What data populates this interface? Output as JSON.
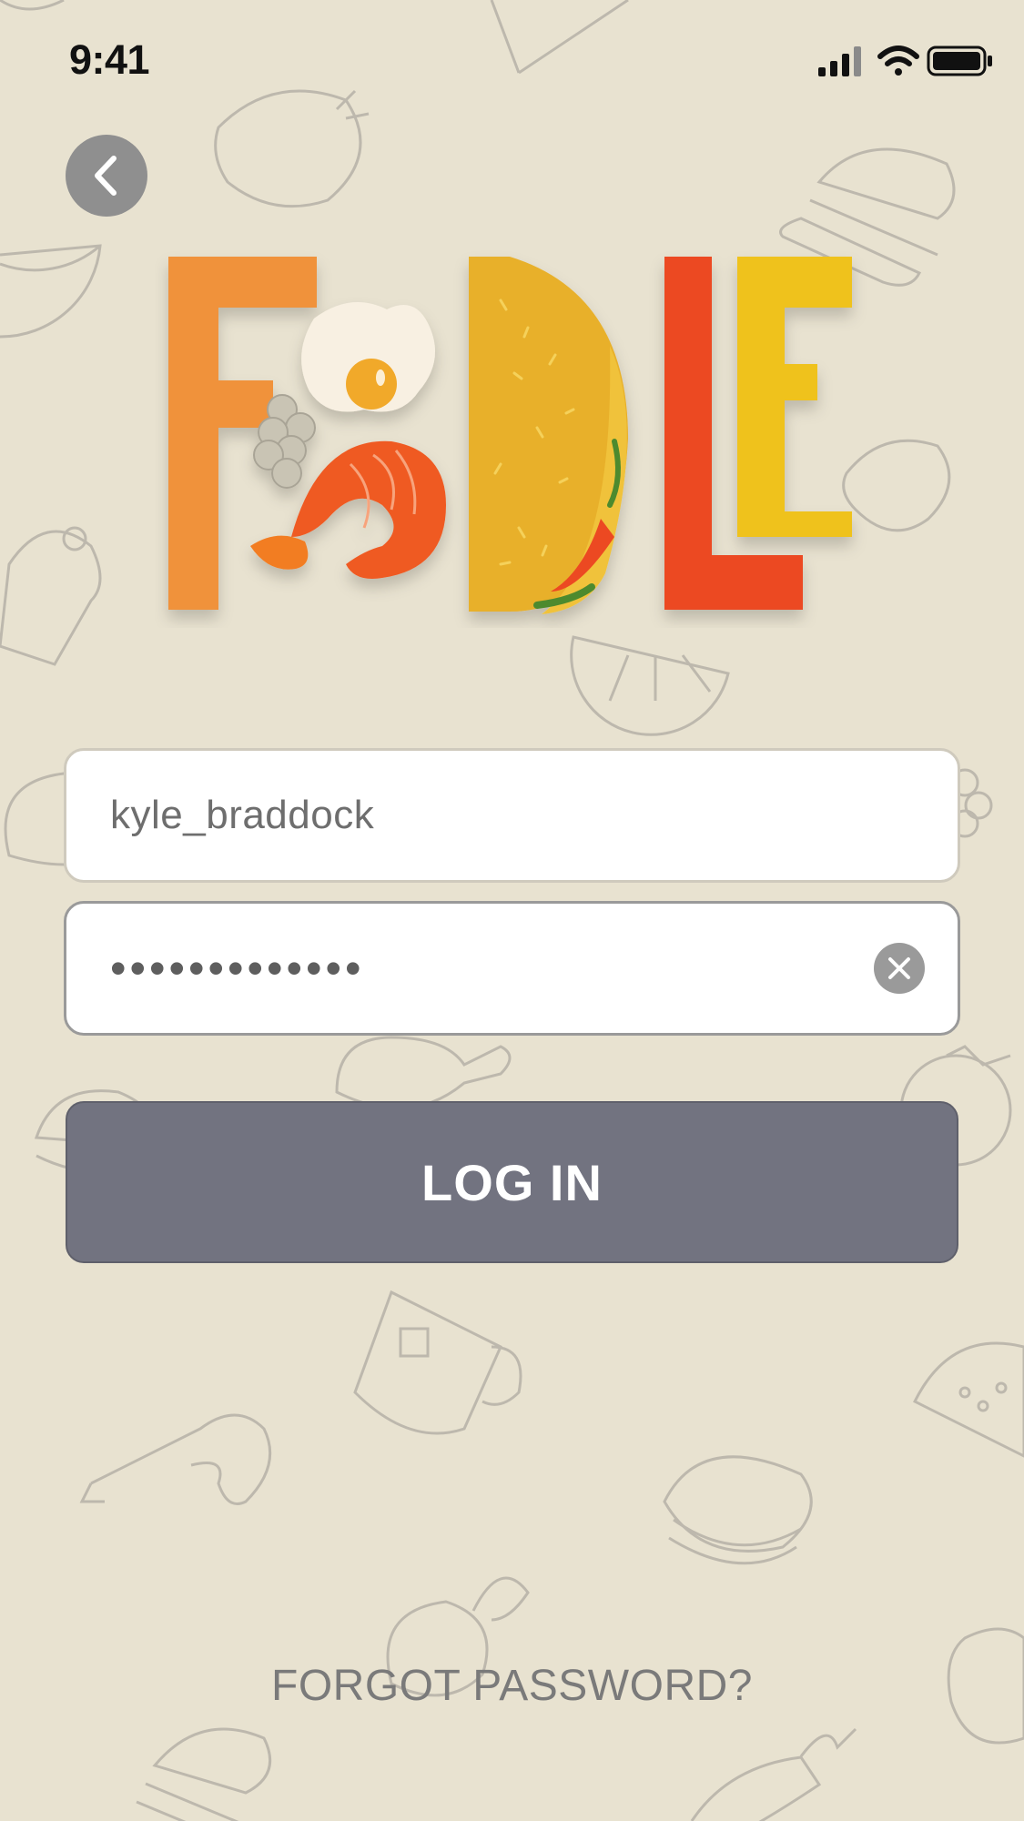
{
  "status_bar": {
    "time": "9:41",
    "signal_icon": "cellular-signal-icon",
    "wifi_icon": "wifi-icon",
    "battery_icon": "battery-icon"
  },
  "header": {
    "back_icon": "chevron-left-icon"
  },
  "logo": {
    "text": "FOODLE",
    "letter_colors": {
      "F": "#f0923a",
      "taco": "#e8b02c",
      "L": "#ec4823",
      "E": "#efc21e"
    }
  },
  "login_form": {
    "username_value": "kyle_braddock",
    "password_value": "•••••••••••••",
    "clear_icon": "clear-circle-icon",
    "submit_label": "LOG IN",
    "forgot_label": "FORGOT PASSWORD?"
  },
  "colors": {
    "background": "#e8e2d0",
    "button": "#727380",
    "doodle_stroke": "#bdb8ad"
  }
}
